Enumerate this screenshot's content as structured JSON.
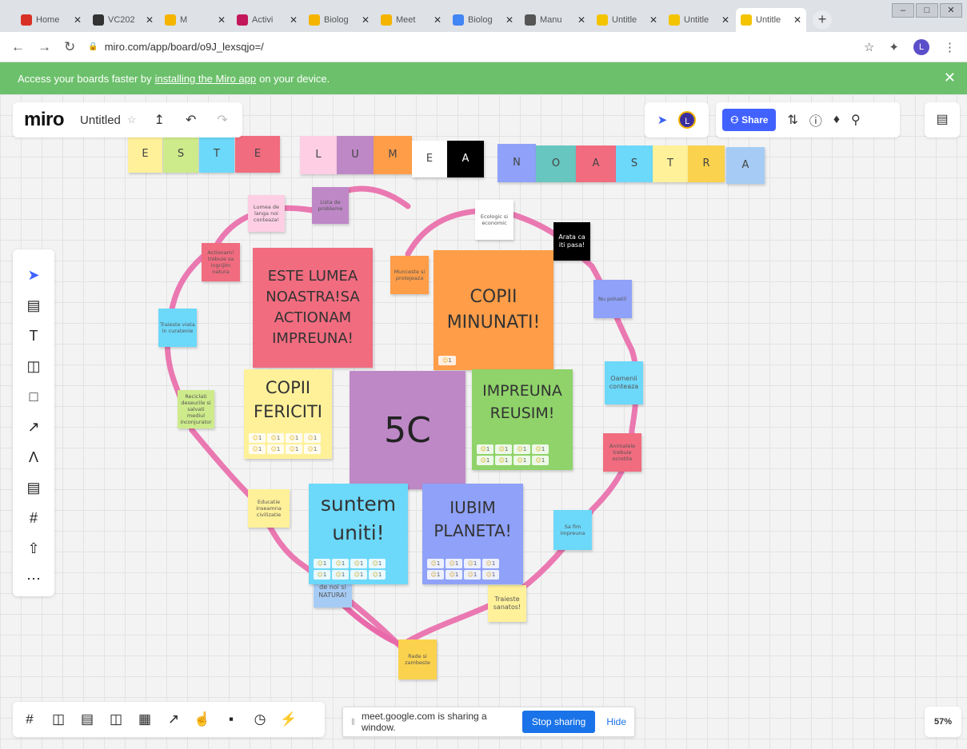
{
  "browser": {
    "tabs": [
      {
        "title": "Home",
        "color": "#d93025"
      },
      {
        "title": "VC202",
        "color": "#333333"
      },
      {
        "title": "M",
        "color": "#f4b400"
      },
      {
        "title": "Activi",
        "color": "#c2185b"
      },
      {
        "title": "Biolog",
        "color": "#f4b400"
      },
      {
        "title": "Meet",
        "color": "#f4b400"
      },
      {
        "title": "Biolog",
        "color": "#4285f4"
      },
      {
        "title": "Manu",
        "color": "#555555"
      },
      {
        "title": "Untitle",
        "color": "#f4c400"
      },
      {
        "title": "Untitle",
        "color": "#f4c400"
      },
      {
        "title": "Untitle",
        "color": "#f4c400"
      }
    ],
    "url": "miro.com/app/board/o9J_lexsqjo=/",
    "profile_initial": "L"
  },
  "banner": {
    "prefix": "Access your boards faster by",
    "link": "installing the Miro app",
    "suffix": "on your device."
  },
  "miro": {
    "logo": "miro",
    "board_name": "Untitled",
    "share_label": "Share",
    "avatar_initial": "L",
    "zoom": "57%"
  },
  "sharing_bar": {
    "message": "meet.google.com is sharing a window.",
    "stop_label": "Stop sharing",
    "hide_label": "Hide"
  },
  "letters": [
    {
      "t": "E",
      "c": "#fff19a"
    },
    {
      "t": "S",
      "c": "#cdeb8b"
    },
    {
      "t": "T",
      "c": "#6cd8fa"
    },
    {
      "t": "E",
      "c": "#f16c7f"
    },
    {
      "t": "L",
      "c": "#fecfe4"
    },
    {
      "t": "U",
      "c": "#be88c7"
    },
    {
      "t": "M",
      "c": "#ff9d48"
    },
    {
      "t": "E",
      "c": "#ffffff"
    },
    {
      "t": "A",
      "c": "#000000"
    },
    {
      "t": "N",
      "c": "#8fa1f8"
    },
    {
      "t": "O",
      "c": "#67c6c0"
    },
    {
      "t": "A",
      "c": "#f16c7f"
    },
    {
      "t": "S",
      "c": "#6cd8fa"
    },
    {
      "t": "T",
      "c": "#fff19a"
    },
    {
      "t": "R",
      "c": "#fad24d"
    },
    {
      "t": "A",
      "c": "#a6ccf5"
    }
  ],
  "notes": {
    "lumea_langa": "Lumea de langa noi conteaza!",
    "lista_probleme": "Lista de probleme",
    "ecologic": "Ecologic si economic",
    "arata": "Arata ca iti pasa!",
    "actionam_trebuie": "Actionam! trebuie sa ingrijim natura",
    "muncește": "Munceste si protejeaza",
    "traieste_curatenie": "Traieste viata in curatenie",
    "blue_right": "Nu poluati!",
    "oamenii": "Oamenii conteaza",
    "green_small": "Reciclati deseurile si salvati mediul inconjurator",
    "animalele": "Animalele trebuie ocrotite",
    "educatie": "Educatie inseamna civilizatie",
    "salvam": "Sa fim impreuna",
    "natura": "de noi si NATURA!",
    "traieste_sanatos": "Traieste sanatos!",
    "radem": "Rade si zambeste",
    "este_lumea": "ESTE LUMEA NOASTRA!SA ACTIONAM IMPREUNA!",
    "copii_minunati": "COPII MINUNATI!",
    "copii_fericiti": "COPII FERICITI",
    "center": "5C",
    "impreuna": "IMPREUNA REUSIM!",
    "suntem": "suntem uniti!",
    "iubim": "IUBIM PLANETA!",
    "reaction_count": "1"
  }
}
